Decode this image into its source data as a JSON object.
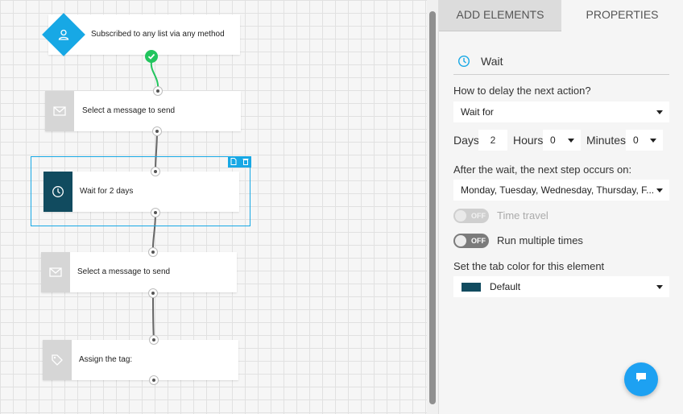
{
  "canvas": {
    "trigger": {
      "label": "Subscribed to any list via any method",
      "icon": "user-icon"
    },
    "nodes": [
      {
        "label": "Select a message to send",
        "icon": "envelope-icon"
      },
      {
        "label": "Wait for 2 days",
        "icon": "clock-icon"
      },
      {
        "label": "Select a message to send",
        "icon": "envelope-icon"
      },
      {
        "label": "Assign the tag:",
        "icon": "tag-icon"
      }
    ]
  },
  "panel": {
    "tabs": {
      "add": "ADD ELEMENTS",
      "properties": "PROPERTIES"
    },
    "title": "Wait",
    "delay_question": "How to delay the next action?",
    "delay_value": "Wait for",
    "days_label": "Days",
    "days_value": "2",
    "hours_label": "Hours",
    "hours_value": "0",
    "minutes_label": "Minutes",
    "minutes_value": "0",
    "after_wait_label": "After the wait, the next step occurs on:",
    "after_wait_value": "Monday, Tuesday, Wednesday, Thursday, F...",
    "time_travel": {
      "label": "Time travel",
      "state": "OFF"
    },
    "run_multiple": {
      "label": "Run multiple times",
      "state": "OFF"
    },
    "tab_color_label": "Set the tab color for this element",
    "tab_color_value": "Default",
    "tab_color_hex": "#114b5f"
  },
  "colors": {
    "accent": "#17a8e5",
    "success": "#22c55e",
    "node_dark": "#114b5f"
  }
}
